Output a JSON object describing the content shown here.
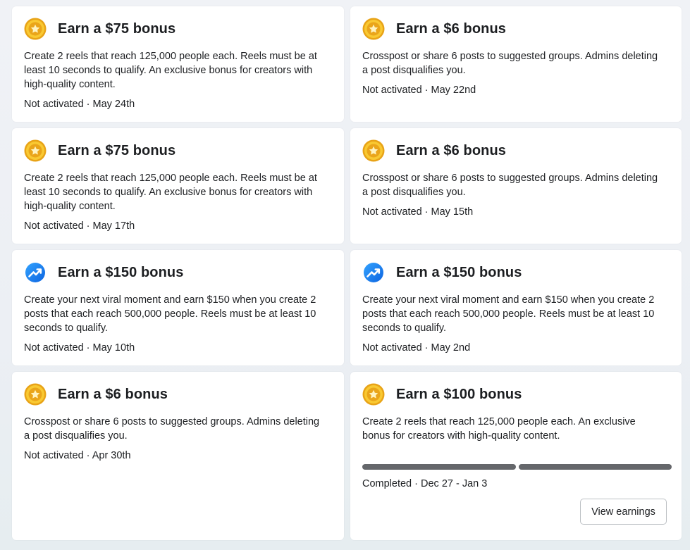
{
  "cards": [
    {
      "icon": "coin-star-icon",
      "title": "Earn a $75 bonus",
      "description": "Create 2 reels that reach 125,000 people each. Reels must be at least 10 seconds to qualify. An exclusive bonus for creators with high-quality content.",
      "status": "Not activated · May 24th"
    },
    {
      "icon": "coin-star-icon",
      "title": "Earn a $6 bonus",
      "description": "Crosspost or share 6 posts to suggested groups. Admins deleting a post disqualifies you.",
      "status": "Not activated · May 22nd"
    },
    {
      "icon": "coin-star-icon",
      "title": "Earn a $75 bonus",
      "description": "Create 2 reels that reach 125,000 people each. Reels must be at least 10 seconds to qualify. An exclusive bonus for creators with high-quality content.",
      "status": "Not activated · May 17th"
    },
    {
      "icon": "coin-star-icon",
      "title": "Earn a $6 bonus",
      "description": "Crosspost or share 6 posts to suggested groups. Admins deleting a post disqualifies you.",
      "status": "Not activated · May 15th"
    },
    {
      "icon": "trending-up-icon",
      "title": "Earn a $150 bonus",
      "description": "Create your next viral moment and earn $150 when you create 2 posts that each reach 500,000 people. Reels must be at least 10 seconds to qualify.",
      "status": "Not activated · May 10th"
    },
    {
      "icon": "trending-up-icon",
      "title": "Earn a $150 bonus",
      "description": "Create your next viral moment and earn $150 when you create 2 posts that each reach 500,000 people. Reels must be at least 10 seconds to qualify.",
      "status": "Not activated · May 2nd"
    },
    {
      "icon": "coin-star-icon",
      "title": "Earn a $6 bonus",
      "description": "Crosspost or share 6 posts to suggested groups. Admins deleting a post disqualifies you.",
      "status": "Not activated · Apr 30th"
    },
    {
      "icon": "coin-star-icon",
      "title": "Earn a $100 bonus",
      "description": "Create 2 reels that reach 125,000 people each. An exclusive bonus for creators with high-quality content.",
      "status": "Completed · Dec 27 - Jan 3",
      "progress": {
        "completed": 2,
        "total": 2
      },
      "button_label": "View earnings"
    }
  ],
  "colors": {
    "coin": "#f7c325",
    "coin_rim": "#e8a317",
    "trend": "#1877f2",
    "progress": "#65676b"
  }
}
